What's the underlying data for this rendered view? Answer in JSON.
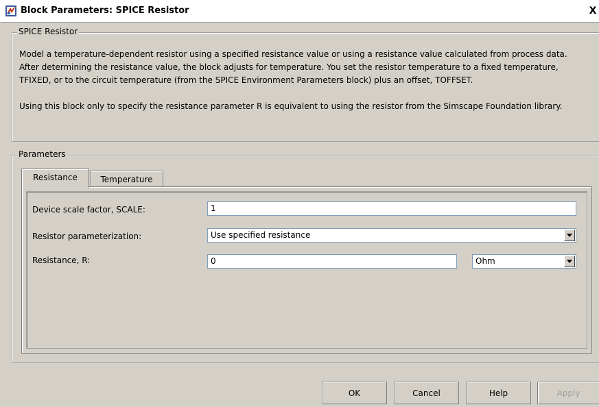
{
  "window": {
    "title": "Block Parameters: SPICE Resistor",
    "close_glyph": "X"
  },
  "description_group": {
    "legend": "SPICE Resistor",
    "paragraph1": "Model a temperature-dependent resistor using a specified resistance value or using a resistance value calculated from process data. After determining the resistance value, the block adjusts for temperature. You set the resistor temperature to a fixed temperature, TFIXED, or to the circuit temperature (from the SPICE Environment Parameters block) plus an offset, TOFFSET.",
    "paragraph2": "Using this block only to specify the resistance parameter R is equivalent to using the resistor from the Simscape Foundation library."
  },
  "parameters_group": {
    "legend": "Parameters",
    "tabs": [
      {
        "label": "Resistance",
        "active": true
      },
      {
        "label": "Temperature",
        "active": false
      }
    ],
    "fields": {
      "scale": {
        "label": "Device scale factor, SCALE:",
        "value": "1"
      },
      "parameterization": {
        "label": "Resistor parameterization:",
        "value": "Use specified resistance"
      },
      "resistance": {
        "label": "Resistance, R:",
        "value": "0",
        "unit": "Ohm"
      }
    }
  },
  "buttons": {
    "ok": "OK",
    "cancel": "Cancel",
    "help": "Help",
    "apply": "Apply"
  }
}
